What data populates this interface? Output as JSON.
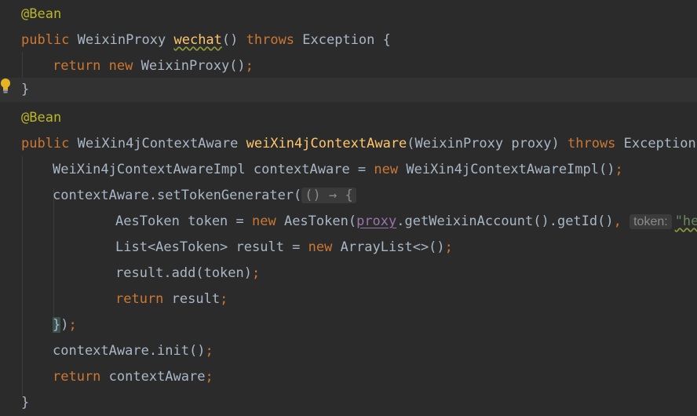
{
  "editor": {
    "lines": [
      [
        {
          "t": "@Bean",
          "c": "ann"
        }
      ],
      [
        {
          "t": "public ",
          "c": "kw"
        },
        {
          "t": "WeixinProxy ",
          "c": "txt"
        },
        {
          "t": "wechat",
          "c": "fn warn"
        },
        {
          "t": "() ",
          "c": "txt"
        },
        {
          "t": "throws ",
          "c": "kw"
        },
        {
          "t": "Exception {",
          "c": "txt"
        }
      ],
      [
        {
          "t": "return ",
          "c": "kw"
        },
        {
          "t": "new ",
          "c": "kw"
        },
        {
          "t": "WeixinProxy()",
          "c": "txt"
        },
        {
          "t": ";",
          "c": "kw"
        }
      ],
      [
        {
          "t": "}",
          "c": "txt"
        }
      ],
      [
        {
          "t": "@Bean",
          "c": "ann"
        }
      ],
      [
        {
          "t": "public ",
          "c": "kw"
        },
        {
          "t": "WeiXin4jContextAware ",
          "c": "txt"
        },
        {
          "t": "weiXin4jContextAware",
          "c": "fn"
        },
        {
          "t": "(WeixinProxy proxy) ",
          "c": "txt"
        },
        {
          "t": "throws ",
          "c": "kw"
        },
        {
          "t": "Exception {",
          "c": "txt"
        }
      ],
      [
        {
          "t": "WeiXin4jContextAwareImpl contextAware = ",
          "c": "txt"
        },
        {
          "t": "new ",
          "c": "kw"
        },
        {
          "t": "WeiXin4jContextAwareImpl()",
          "c": "txt"
        },
        {
          "t": ";",
          "c": "kw"
        }
      ],
      [
        {
          "t": "contextAware.setTokenGenerater(",
          "c": "txt"
        },
        {
          "t": "() → {",
          "c": "fold-hint"
        }
      ],
      [
        {
          "t": "AesToken token = ",
          "c": "txt"
        },
        {
          "t": "new ",
          "c": "kw"
        },
        {
          "t": "AesToken(",
          "c": "txt"
        },
        {
          "t": "proxy",
          "c": "field"
        },
        {
          "t": ".getWeixinAccount().getId()",
          "c": "txt"
        },
        {
          "t": ", ",
          "c": "kw"
        },
        {
          "t": "token:",
          "c": "param-hint"
        },
        {
          "t": "\"hello\"",
          "c": "str warn"
        }
      ],
      [
        {
          "t": "List<AesToken> result = ",
          "c": "txt"
        },
        {
          "t": "new ",
          "c": "kw"
        },
        {
          "t": "ArrayList<>()",
          "c": "txt"
        },
        {
          "t": ";",
          "c": "kw"
        }
      ],
      [
        {
          "t": "result.add(token)",
          "c": "txt"
        },
        {
          "t": ";",
          "c": "kw"
        }
      ],
      [
        {
          "t": "return ",
          "c": "kw"
        },
        {
          "t": "result",
          "c": "txt"
        },
        {
          "t": ";",
          "c": "kw"
        }
      ],
      [
        {
          "t": "}",
          "c": "txt brace-hl"
        },
        {
          "t": ")",
          "c": "txt"
        },
        {
          "t": ";",
          "c": "kw"
        }
      ],
      [
        {
          "t": "contextAware.init()",
          "c": "txt"
        },
        {
          "t": ";",
          "c": "kw"
        }
      ],
      [
        {
          "t": "return ",
          "c": "kw"
        },
        {
          "t": "contextAware",
          "c": "txt"
        },
        {
          "t": ";",
          "c": "kw"
        }
      ],
      [
        {
          "t": "}",
          "c": "txt"
        }
      ]
    ],
    "current_line_index": 3,
    "gutter_icon": "lightbulb-icon",
    "colors": {
      "background": "#2b2b2b",
      "current_line": "#323232",
      "keyword": "#cc7832",
      "annotation": "#bbb529",
      "method": "#ffc66d",
      "field": "#9876aa",
      "string": "#6a8759",
      "text": "#a9b7c6"
    }
  }
}
